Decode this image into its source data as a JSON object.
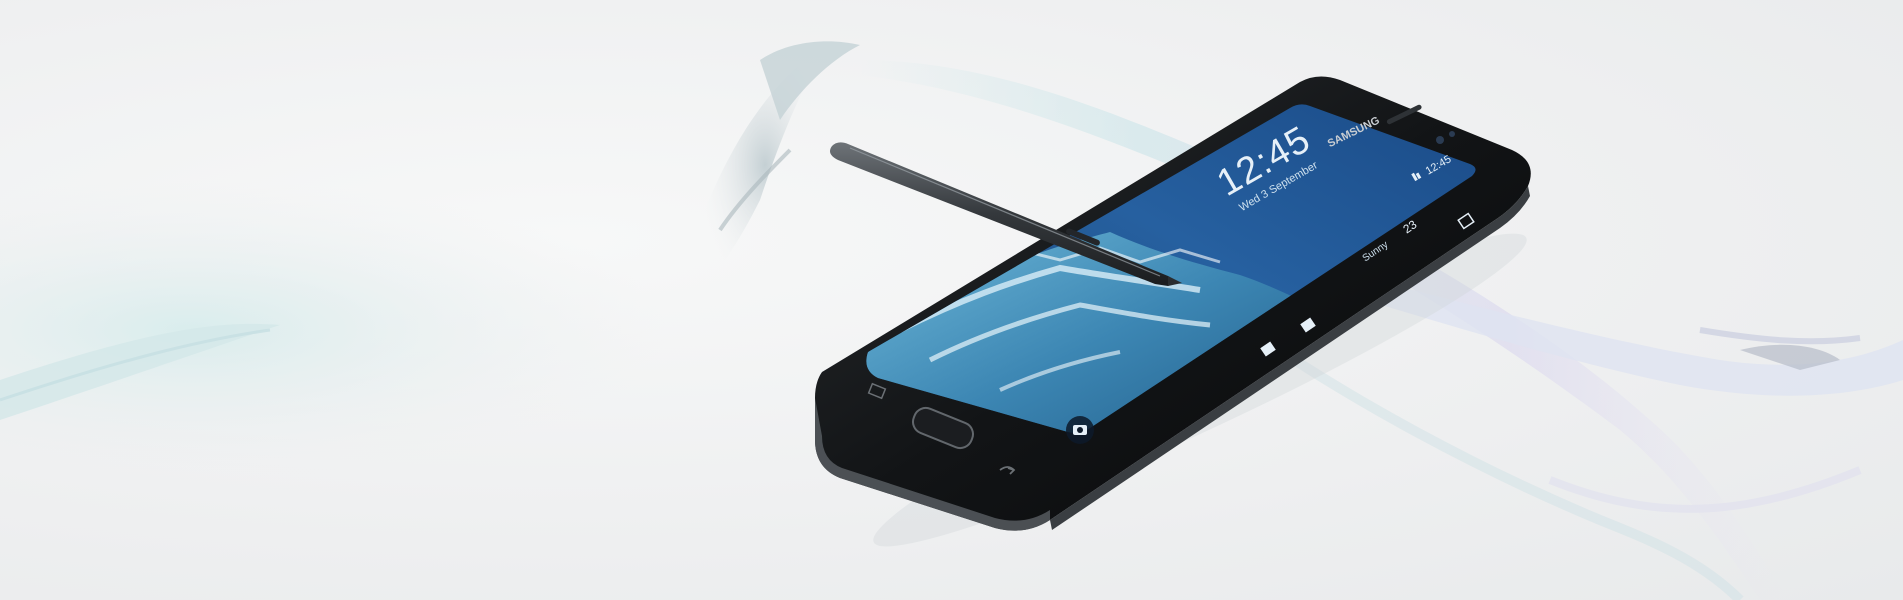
{
  "phone": {
    "brand": "SAMSUNG",
    "time": "12:45",
    "date": "Wed 3 September",
    "status_time": "12:45",
    "edge_weather_temp": "23",
    "edge_weather_label": "Sunny"
  },
  "colors": {
    "background": "#eeeff0",
    "phone_body": "#121416",
    "screen_blue": "#1e4f8a"
  }
}
